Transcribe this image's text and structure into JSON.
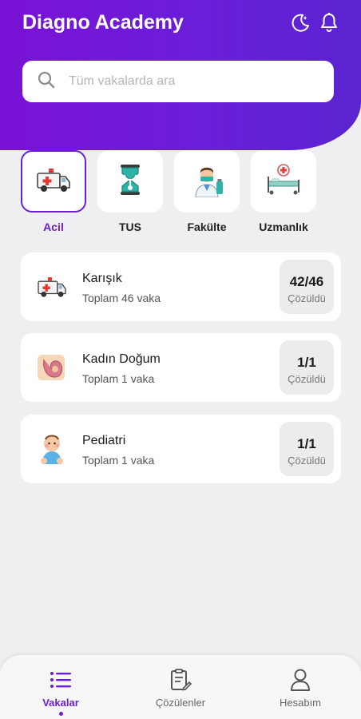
{
  "header": {
    "title": "Diagno Academy",
    "icons": [
      "moon-icon",
      "bell-icon"
    ]
  },
  "search": {
    "placeholder": "Tüm vakalarda ara"
  },
  "categories": [
    {
      "label": "Acil",
      "icon": "ambulance-icon",
      "active": true
    },
    {
      "label": "TUS",
      "icon": "hourglass-stethoscope-icon",
      "active": false
    },
    {
      "label": "Fakülte",
      "icon": "doctor-icon",
      "active": false
    },
    {
      "label": "Uzmanlık",
      "icon": "hospital-bed-icon",
      "active": false
    }
  ],
  "cases": [
    {
      "title": "Karışık",
      "subtitle": "Toplam 46 vaka",
      "count": "42/46",
      "count_label": "Çözüldü",
      "icon": "ambulance-icon"
    },
    {
      "title": "Kadın Doğum",
      "subtitle": "Toplam 1 vaka",
      "count": "1/1",
      "count_label": "Çözüldü",
      "icon": "uterus-icon"
    },
    {
      "title": "Pediatri",
      "subtitle": "Toplam 1 vaka",
      "count": "1/1",
      "count_label": "Çözüldü",
      "icon": "baby-icon"
    }
  ],
  "nav": [
    {
      "label": "Vakalar",
      "icon": "list-icon",
      "active": true
    },
    {
      "label": "Çözülenler",
      "icon": "clipboard-edit-icon",
      "active": false
    },
    {
      "label": "Hesabım",
      "icon": "user-icon",
      "active": false
    }
  ],
  "colors": {
    "primary": "#6a1ed8",
    "background": "#efeff1",
    "card": "#ffffff"
  }
}
